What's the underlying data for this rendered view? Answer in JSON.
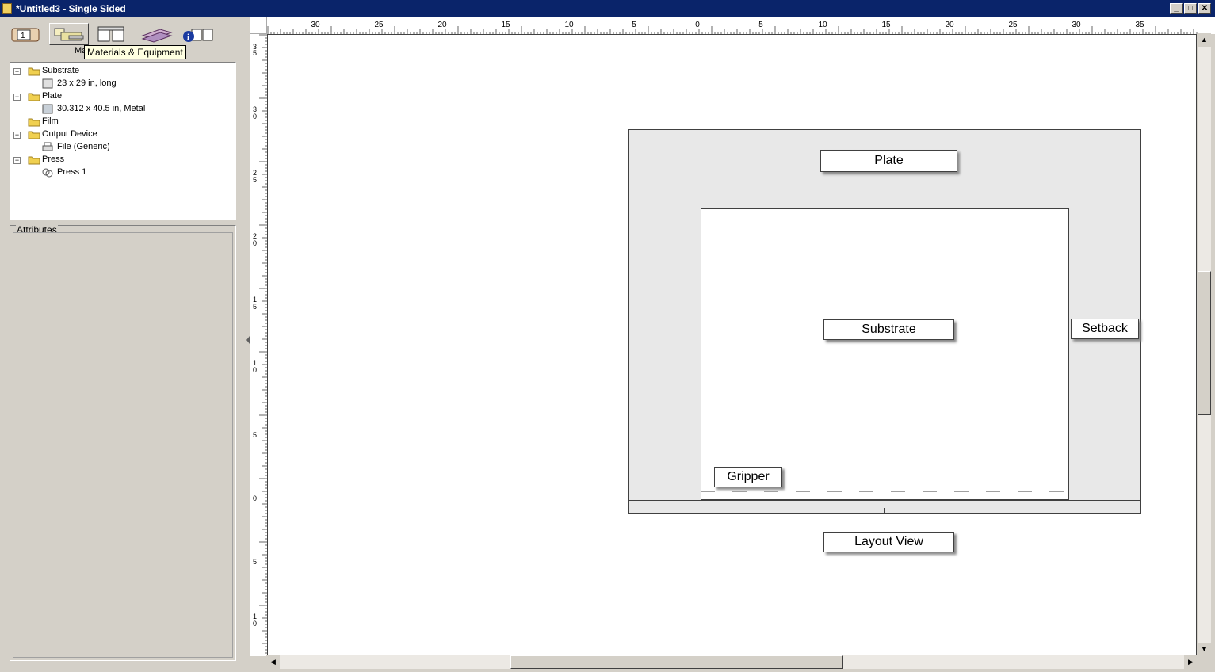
{
  "window": {
    "title": "*Untitled3 - Single Sided",
    "minimize": "_",
    "maximize": "□",
    "close": "✕"
  },
  "toolbar": {
    "tabs": [
      {
        "icon": "job-icon"
      },
      {
        "icon": "materials-equipment-icon"
      },
      {
        "icon": "layout-icon"
      },
      {
        "icon": "stack-icon"
      },
      {
        "icon": "info-icon"
      }
    ],
    "tooltip": "Materials & Equipment",
    "panel_title": "Ma"
  },
  "tree": [
    {
      "label": "Substrate",
      "level": 0,
      "toggle": "−",
      "icon": "folder-icon"
    },
    {
      "label": "23 x 29 in, long",
      "level": 1,
      "icon": "substrate-sheet-icon"
    },
    {
      "label": "Plate",
      "level": 0,
      "toggle": "−",
      "icon": "folder-icon"
    },
    {
      "label": "30.312 x 40.5 in, Metal",
      "level": 1,
      "icon": "plate-icon"
    },
    {
      "label": "Film",
      "level": 0,
      "icon": "folder-icon"
    },
    {
      "label": "Output Device",
      "level": 0,
      "toggle": "−",
      "icon": "folder-icon"
    },
    {
      "label": "File (Generic)",
      "level": 1,
      "icon": "file-device-icon"
    },
    {
      "label": "Press",
      "level": 0,
      "toggle": "−",
      "icon": "folder-icon"
    },
    {
      "label": "Press 1",
      "level": 1,
      "icon": "press-icon"
    }
  ],
  "attributes": {
    "title": "Attributes"
  },
  "ruler": {
    "h_labels": [
      "30",
      "25",
      "20",
      "15",
      "10",
      "5",
      "0",
      "5",
      "10",
      "15",
      "20",
      "25",
      "30",
      "35"
    ],
    "v_labels": [
      [
        "3",
        "5"
      ],
      [
        "3",
        "0"
      ],
      [
        "2",
        "5"
      ],
      [
        "2",
        "0"
      ],
      [
        "1",
        "5"
      ],
      [
        "1",
        "0"
      ],
      [
        "5"
      ],
      [
        "0"
      ],
      [
        "5"
      ],
      [
        "1",
        "0"
      ]
    ]
  },
  "layout": {
    "plate_label": "Plate",
    "substrate_label": "Substrate",
    "setback_label": "Setback",
    "gripper_label": "Gripper",
    "view_label": "Layout View"
  }
}
